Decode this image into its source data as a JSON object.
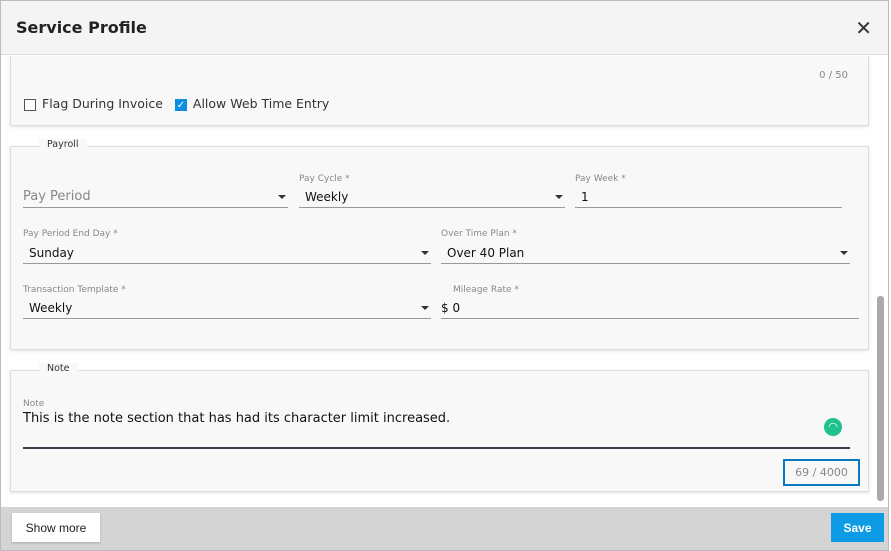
{
  "header": {
    "title": "Service Profile"
  },
  "top": {
    "counter": "0 / 50",
    "flag_label": "Flag During Invoice",
    "flag_checked": false,
    "web_label": "Allow Web Time Entry",
    "web_checked": true
  },
  "payroll": {
    "legend": "Payroll",
    "pay_period": {
      "placeholder": "Pay Period"
    },
    "pay_cycle": {
      "label": "Pay Cycle *",
      "value": "Weekly"
    },
    "pay_week": {
      "label": "Pay Week *",
      "value": "1"
    },
    "end_day": {
      "label": "Pay Period End Day *",
      "value": "Sunday"
    },
    "ot_plan": {
      "label": "Over Time Plan *",
      "value": "Over 40 Plan"
    },
    "template": {
      "label": "Transaction Template *",
      "value": "Weekly"
    },
    "mileage": {
      "label": "Mileage Rate *",
      "value": "$ 0"
    }
  },
  "note": {
    "legend": "Note",
    "label": "Note",
    "value": "This is the note section that has had its character limit increased.",
    "counter": "69 / 4000"
  },
  "footer": {
    "show_more": "Show more",
    "save": "Save"
  },
  "colors": {
    "accent": "#0d8fe0",
    "counter_outline": "#0a7ac0",
    "status": "#1fc28f"
  }
}
